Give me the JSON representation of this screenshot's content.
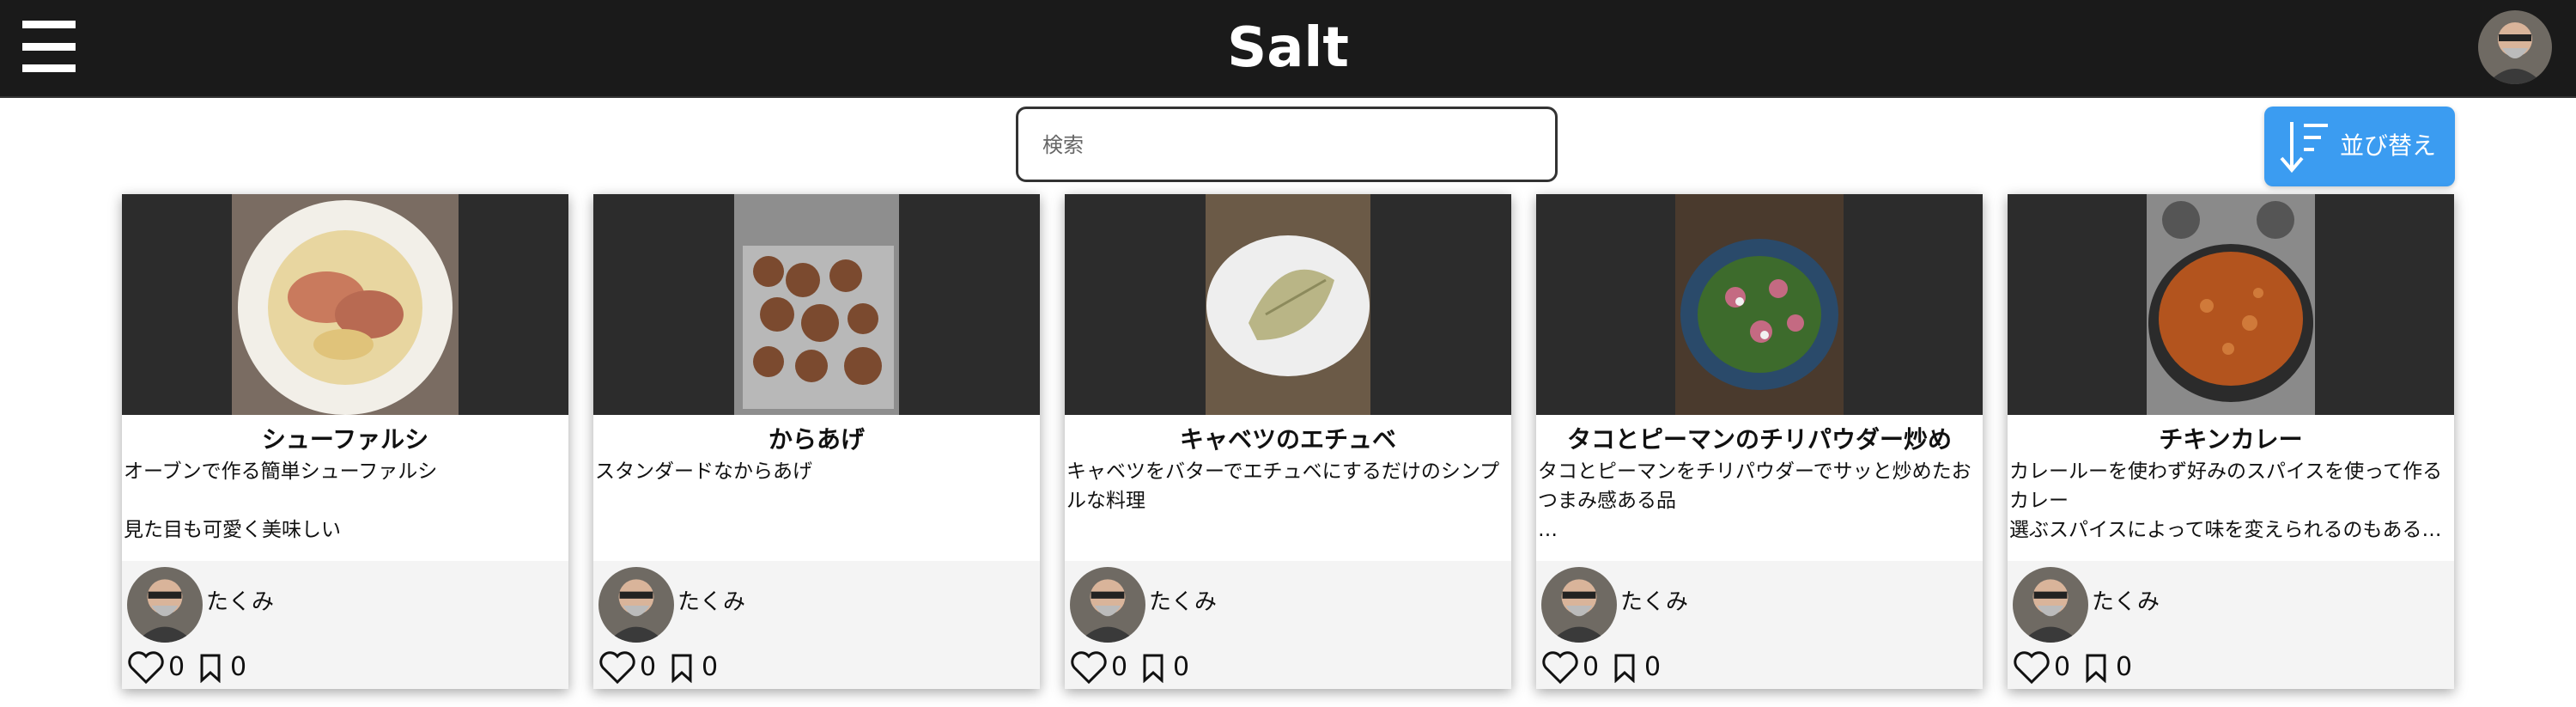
{
  "header": {
    "app_title": "Salt",
    "menu_icon": "hamburger-menu-icon",
    "avatar_icon": "user-avatar"
  },
  "search": {
    "placeholder": "検索",
    "value": ""
  },
  "sort": {
    "label": "並び替え",
    "icon": "sort-descending-icon"
  },
  "colors": {
    "header_bg": "#1a1a1a",
    "accent": "#3b9cf1",
    "card_footer_bg": "#f4f4f4"
  },
  "recipes": [
    {
      "title": "シューファルシ",
      "description": "オーブンで作る簡単シューファルシ\n\n見た目も可愛く美味しい",
      "author": "たくみ",
      "likes": "0",
      "saves": "0"
    },
    {
      "title": "からあげ",
      "description": "スタンダードなからあげ",
      "author": "たくみ",
      "likes": "0",
      "saves": "0"
    },
    {
      "title": "キャベツのエチュベ",
      "description": "キャベツをバターでエチュベにするだけのシンプルな料理",
      "author": "たくみ",
      "likes": "0",
      "saves": "0"
    },
    {
      "title": "タコとピーマンのチリパウダー炒め",
      "description": "タコとピーマンをチリパウダーでサッと炒めたおつまみ感ある品\n…",
      "author": "たくみ",
      "likes": "0",
      "saves": "0"
    },
    {
      "title": "チキンカレー",
      "description": "カレールーを使わず好みのスパイスを使って作るカレー\n選ぶスパイスによって味を変えられるのもある…",
      "author": "たくみ",
      "likes": "0",
      "saves": "0"
    }
  ]
}
